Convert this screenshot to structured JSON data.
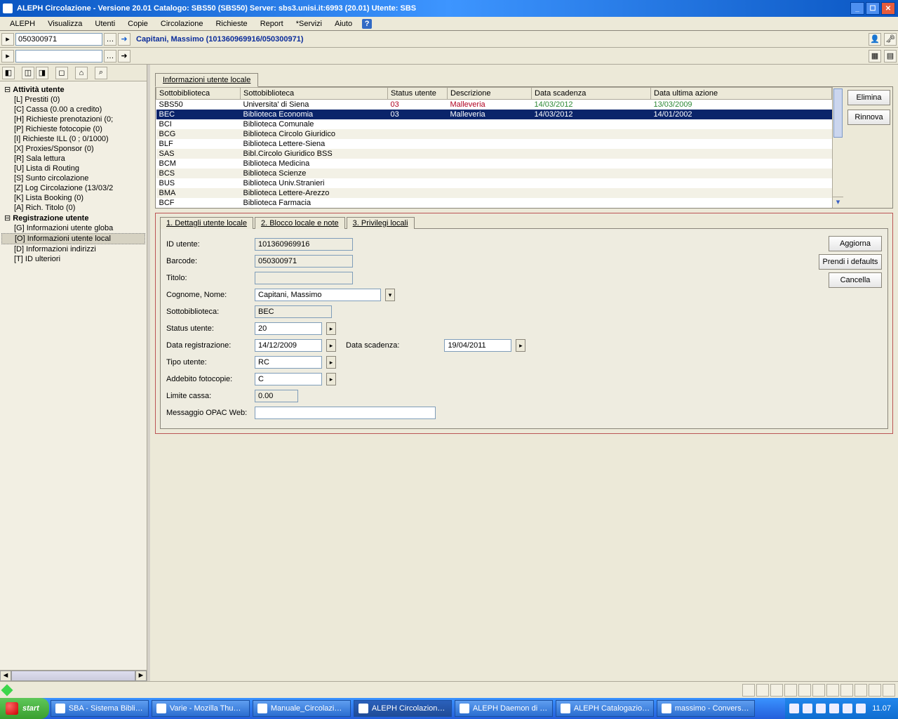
{
  "titlebar": {
    "text": "ALEPH Circolazione - Versione 20.01  Catalogo:  SBS50 (SBS50)  Server:  sbs3.unisi.it:6993 (20.01)  Utente:  SBS"
  },
  "menu": [
    "ALEPH",
    "Visualizza",
    "Utenti",
    "Copie",
    "Circolazione",
    "Richieste",
    "Report",
    "*Servizi",
    "Aiuto"
  ],
  "toolbar": {
    "search_value": "050300971",
    "breadcrumb": "Capitani, Massimo (101360969916/050300971)"
  },
  "tree": {
    "root1": "Attività utente",
    "items1": [
      "[L] Prestiti (0)",
      "[C] Cassa (0.00 a credito)",
      "[H] Richieste prenotazioni (0;",
      "[P] Richieste fotocopie (0)",
      "[I] Richieste ILL (0 ; 0/1000)",
      "[X] Proxies/Sponsor (0)",
      "[R] Sala lettura",
      "[U] Lista di Routing",
      "[S] Sunto circolazione",
      "[Z] Log Circolazione (13/03/2",
      "[K] Lista Booking (0)",
      "[A] Rich. Titolo (0)"
    ],
    "root2": "Registrazione utente",
    "items2": [
      "[G] Informazioni utente globa",
      "[O] Informazioni utente local",
      "[D] Informazioni indirizzi",
      "[T] ID ulteriori"
    ],
    "selected": "[O] Informazioni utente local"
  },
  "upper_tab": "Informazioni utente locale",
  "table": {
    "headers": [
      "Sottobiblioteca",
      "Sottobiblioteca",
      "Status utente",
      "Descrizione",
      "Data scadenza",
      "Data ultima azione"
    ],
    "rows": [
      {
        "c": [
          "SBS50",
          "Universita' di Siena",
          "03",
          "Malleveria",
          "14/03/2012",
          "13/03/2009"
        ],
        "hl": "first"
      },
      {
        "c": [
          "BEC",
          "Biblioteca Economia",
          "03",
          "Malleveria",
          "14/03/2012",
          "14/01/2002"
        ],
        "hl": "sel"
      },
      {
        "c": [
          "BCI",
          "Biblioteca Comunale",
          "",
          "",
          "",
          ""
        ]
      },
      {
        "c": [
          "BCG",
          "Biblioteca Circolo Giuridico",
          "",
          "",
          "",
          ""
        ]
      },
      {
        "c": [
          "BLF",
          "Biblioteca Lettere-Siena",
          "",
          "",
          "",
          ""
        ]
      },
      {
        "c": [
          "SAS",
          "Bibl.Circolo Giuridico BSS",
          "",
          "",
          "",
          ""
        ]
      },
      {
        "c": [
          "BCM",
          "Biblioteca Medicina",
          "",
          "",
          "",
          ""
        ]
      },
      {
        "c": [
          "BCS",
          "Biblioteca Scienze",
          "",
          "",
          "",
          ""
        ]
      },
      {
        "c": [
          "BUS",
          "Biblioteca Univ.Stranieri",
          "",
          "",
          "",
          ""
        ]
      },
      {
        "c": [
          "BMA",
          "Biblioteca Lettere-Arezzo",
          "",
          "",
          "",
          ""
        ]
      },
      {
        "c": [
          "BCF",
          "Biblioteca Farmacia",
          "",
          "",
          "",
          ""
        ]
      }
    ],
    "btn_elimina": "Elimina",
    "btn_rinnova": "Rinnova"
  },
  "form": {
    "tabs": [
      "1. Dettagli utente locale",
      "2. Blocco locale e note",
      "3. Privilegi locali"
    ],
    "lbl_id": "ID utente:",
    "val_id": "101360969916",
    "lbl_barcode": "Barcode:",
    "val_barcode": "050300971",
    "lbl_titolo": "Titolo:",
    "val_titolo": "",
    "lbl_nome": "Cognome, Nome:",
    "val_nome": "Capitani, Massimo",
    "lbl_sotto": "Sottobiblioteca:",
    "val_sotto": "BEC",
    "lbl_status": "Status utente:",
    "val_status": "20",
    "lbl_reg": "Data registrazione:",
    "val_reg": "14/12/2009",
    "lbl_scad": "Data scadenza:",
    "val_scad": "19/04/2011",
    "lbl_tipo": "Tipo utente:",
    "val_tipo": "RC",
    "lbl_addebito": "Addebito fotocopie:",
    "val_addebito": "C",
    "lbl_limite": "Limite cassa:",
    "val_limite": "0.00",
    "lbl_opac": "Messaggio OPAC Web:",
    "val_opac": "",
    "btn_aggiorna": "Aggiorna",
    "btn_defaults": "Prendi i defaults",
    "btn_cancella": "Cancella"
  },
  "taskbar": {
    "start": "start",
    "tasks": [
      "SBA - Sistema Bibli…",
      "Varie - Mozilla Thu…",
      "Manuale_Circolazi…",
      "ALEPH Circolazion…",
      "ALEPH Daemon di …",
      "ALEPH Catalogazio…",
      "massimo - Convers…"
    ],
    "active_idx": 3,
    "clock": "11.07"
  }
}
